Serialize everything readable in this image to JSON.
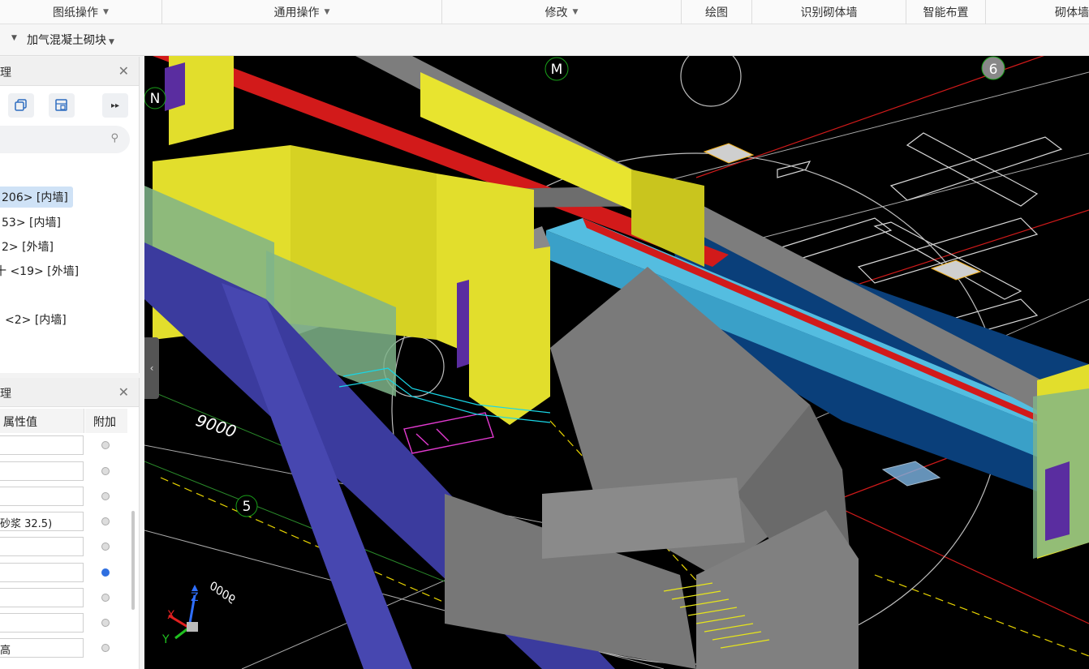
{
  "ribbon": {
    "groups": [
      {
        "label": "图纸操作",
        "dropdown": true
      },
      {
        "label": "通用操作",
        "dropdown": true
      },
      {
        "label": "修改",
        "dropdown": true
      },
      {
        "label": "绘图",
        "dropdown": false
      },
      {
        "label": "识别砌体墙",
        "dropdown": false
      },
      {
        "label": "智能布置",
        "dropdown": false
      },
      {
        "label": "砌体墙二",
        "dropdown": false
      }
    ]
  },
  "toolbar2": {
    "material_select": "加气混凝土砌块"
  },
  "tree_panel": {
    "title": "理",
    "search_placeholder": "",
    "items": [
      {
        "label": "206> [内墙]",
        "selected": true
      },
      {
        "label": "53> [内墙]",
        "selected": false
      },
      {
        "label": "2> [外墙]",
        "selected": false
      },
      {
        "label": "十 <19> [外墙]",
        "selected": false
      },
      {
        "label": "<2> [内墙]",
        "selected": false
      }
    ]
  },
  "prop_panel": {
    "title": "理",
    "col_value": "属性值",
    "col_extra": "附加",
    "rows": [
      {
        "value": "",
        "checked": false
      },
      {
        "value": "",
        "checked": false
      },
      {
        "value": "",
        "checked": false
      },
      {
        "value": "砂浆 32.5)",
        "checked": false
      },
      {
        "value": "",
        "checked": false
      },
      {
        "value": "",
        "checked": true
      },
      {
        "value": "",
        "checked": false
      },
      {
        "value": "",
        "checked": false
      },
      {
        "value": "高",
        "checked": false
      }
    ]
  },
  "viewport": {
    "axis_labels": [
      "N",
      "M",
      "6",
      "5"
    ],
    "dimension_labels": [
      "9000",
      "9000"
    ],
    "axes": {
      "x": "X",
      "y": "Y",
      "z": "Z"
    }
  }
}
